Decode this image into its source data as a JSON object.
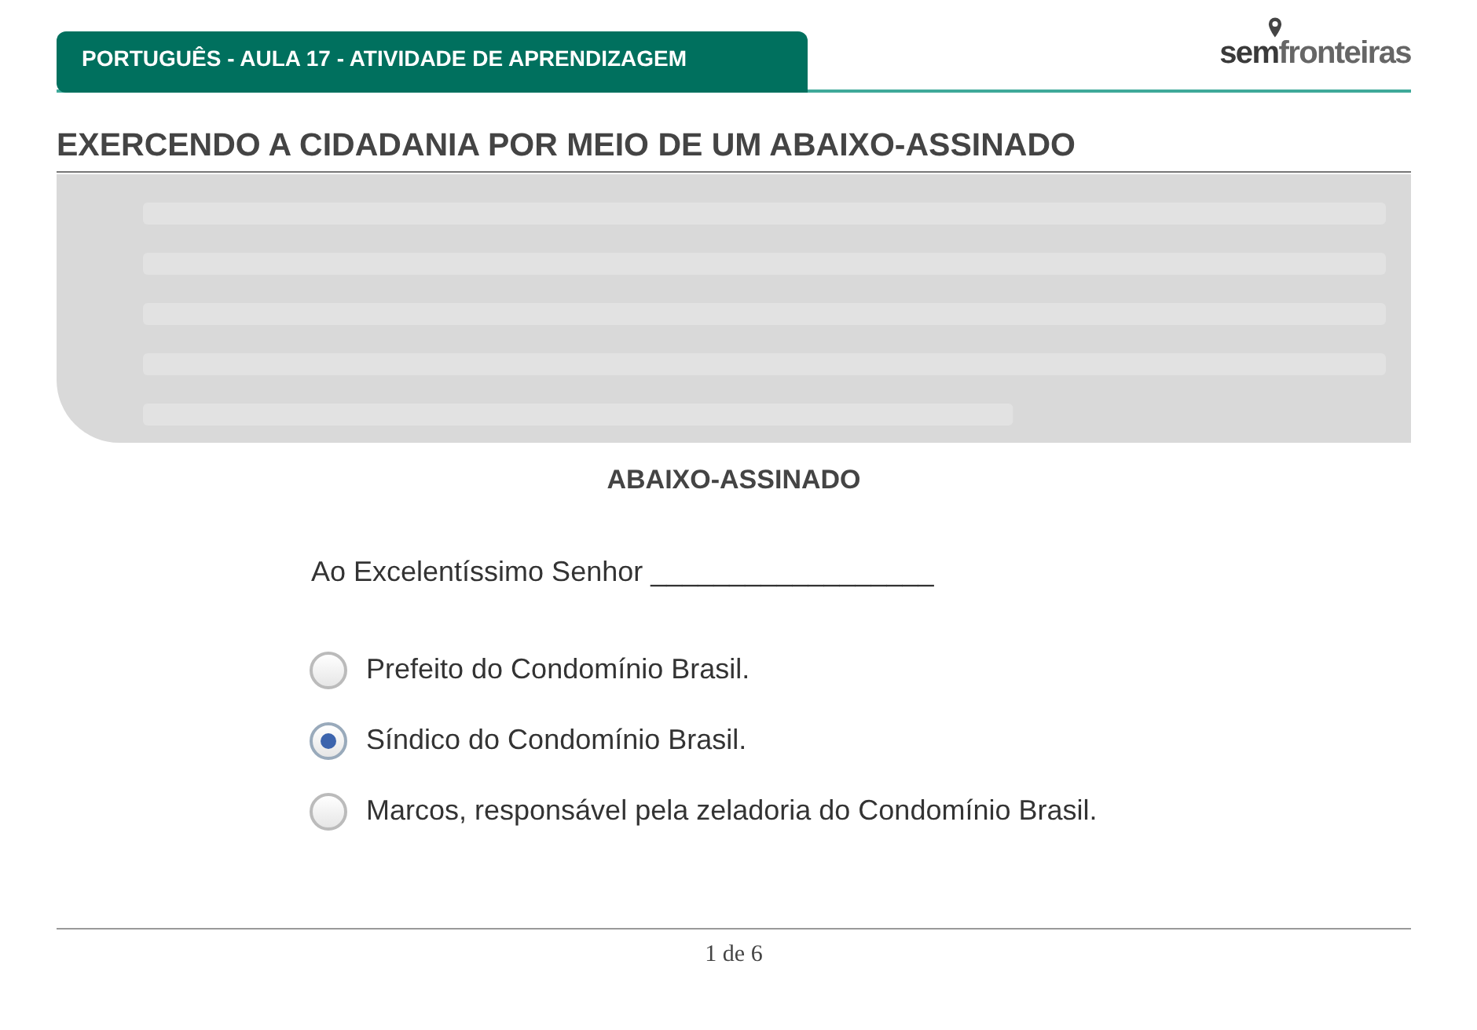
{
  "header": {
    "title": "PORTUGUÊS - AULA 17 - ATIVIDADE DE APRENDIZAGEM",
    "logo": [
      "sem",
      "fronteiras"
    ]
  },
  "heading": "EXERCENDO A CIDADANIA POR MEIO DE UM ABAIXO-ASSINADO",
  "document": {
    "title": "ABAIXO-ASSINADO",
    "salutation": "Ao Excelentíssimo Senhor __________________",
    "options": [
      {
        "label": "Prefeito do Condomínio Brasil.",
        "selected": false
      },
      {
        "label": "Síndico do Condomínio Brasil.",
        "selected": true
      },
      {
        "label": "Marcos, responsável pela zeladoria do Condomínio Brasil.",
        "selected": false
      }
    ]
  },
  "footer": {
    "page": "1 de 6"
  }
}
